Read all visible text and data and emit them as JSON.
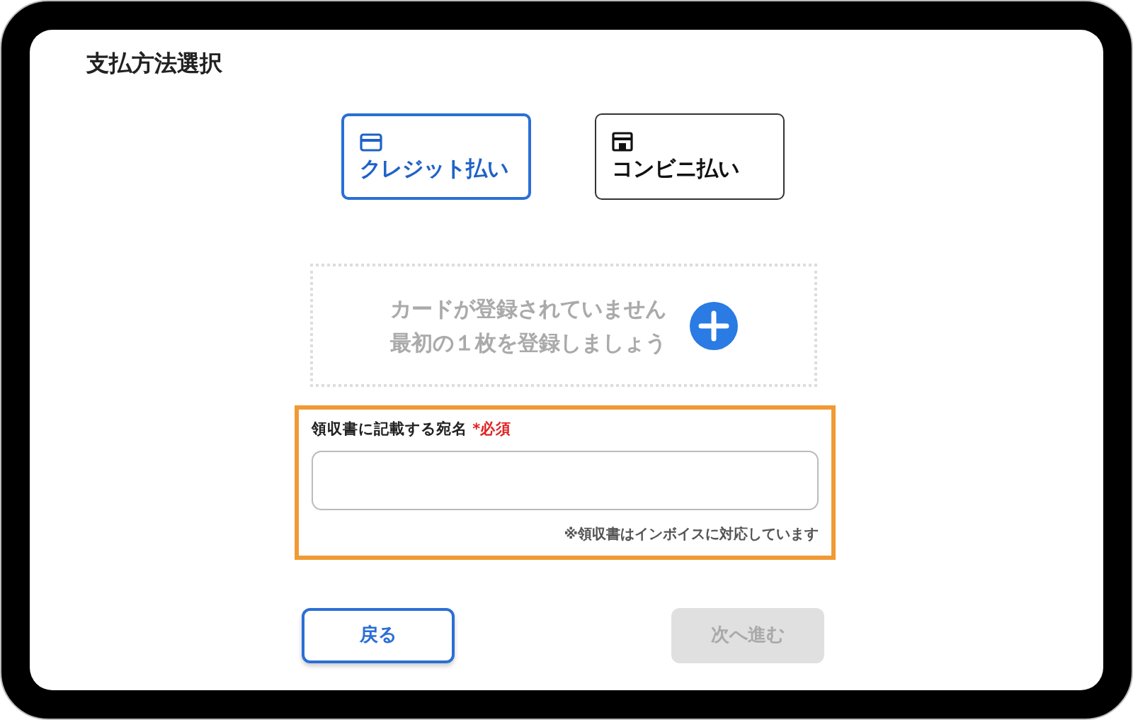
{
  "title": "支払方法選択",
  "payment_methods": [
    {
      "kind": "card",
      "label": "クレジット払い",
      "selected": true
    },
    {
      "kind": "store",
      "label": "コンビニ払い",
      "selected": false
    }
  ],
  "card_empty": {
    "lines": [
      "カードが登録されていません",
      "最初の１枚を登録しましょう"
    ]
  },
  "receipt": {
    "highlighted": true,
    "label": "領収書に記載する宛名",
    "required": "*必須",
    "note": "※領収書はインボイスに対応しています"
  },
  "buttons": [
    {
      "label": "戻る",
      "disabled": false
    },
    {
      "label": "次へ進む",
      "disabled": true
    }
  ]
}
